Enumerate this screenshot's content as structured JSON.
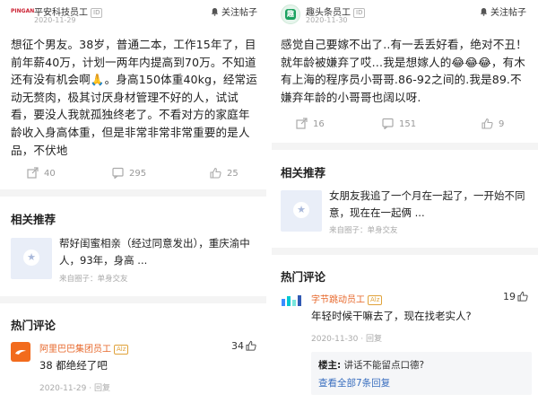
{
  "left": {
    "author": "平安科技员工",
    "author_badge": "ID",
    "avatar_text": "PINGAN",
    "time": "2020-11-29",
    "follow_label": "关注帖子",
    "body": "想征个男友。38岁，普通二本，工作15年了，目前年薪40万，计划一两年内提高到70万。不知道还有没有机会啊🙏。身高150体重40kg，经常运动无赘肉，极其讨厌身材管理不好的人，试试看，要没人我就孤独终老了。不看对方的家庭年龄收入身高体重，但是非常非常非常重要的是人品，不伏地",
    "actions": {
      "share": "40",
      "comments": "295",
      "likes": "25"
    },
    "related_title": "相关推荐",
    "related": {
      "text": "帮好闺蜜相亲（经过同意发出），重庆渝中人，93年，身高 ...",
      "from": "来自圈子：单身交友"
    },
    "hot_title": "热门评论",
    "comment": {
      "author": "阿里巴巴集团员工",
      "tag": "Alz",
      "text": "38 都绝经了吧",
      "likes": "34",
      "date": "2020-11-29",
      "reply_label": "回复",
      "separator": "·"
    }
  },
  "right": {
    "author": "趣头条员工",
    "author_badge": "ID",
    "avatar_text": "趣",
    "time": "2020-11-30",
    "follow_label": "关注帖子",
    "body": "感觉自己要嫁不出了..有一丢丢好看，绝对不丑！就年龄被嫌弃了哎…我是想嫁人的😂😂😂，有木有上海的程序员小哥哥.86-92之间的.我是89.不嫌弃年龄的小哥哥也阔以呀.",
    "actions": {
      "share": "16",
      "comments": "151",
      "likes": "9"
    },
    "related_title": "相关推荐",
    "related": {
      "text": "女朋友我追了一个月在一起了，一开始不同意，现在在一起俩 ...",
      "from": "来自圈子：单身交友"
    },
    "hot_title": "热门评论",
    "comment": {
      "author": "字节跳动员工",
      "tag": "Alz",
      "text": "年轻时候干嘛去了，现在找老实人?",
      "likes": "19",
      "date": "2020-11-30",
      "reply_label": "回复",
      "separator": "·"
    },
    "reply": {
      "owner_label": "楼主:",
      "owner_text": "讲话不能留点口德?",
      "more_label": "查看全部7条回复"
    }
  }
}
